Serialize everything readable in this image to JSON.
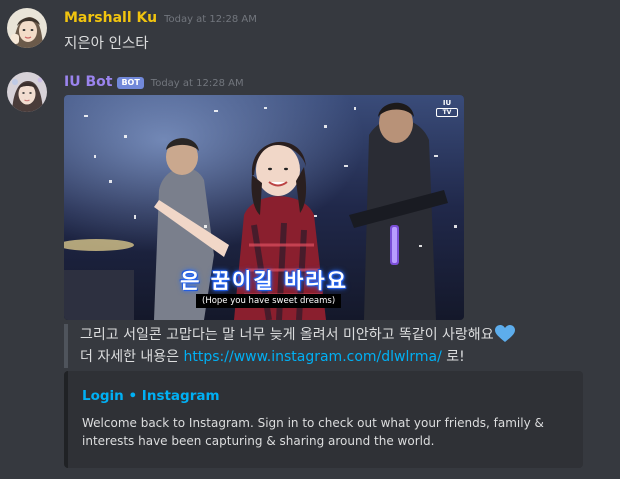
{
  "messages": [
    {
      "username": "Marshall Ku",
      "username_color": "#f1c40f",
      "timestamp": "Today at 12:28 AM",
      "text": "지은아 인스타"
    },
    {
      "username": "IU Bot",
      "username_color": "#9b84ee",
      "bot_tag": "BOT",
      "timestamp": "Today at 12:28 AM",
      "video": {
        "corner_logo_top": "IU",
        "corner_logo_bottom": "TV",
        "overlay_caption": "은 꿈이길 바라요",
        "subtitle": "(Hope you have sweet dreams)"
      },
      "quote": {
        "line1": "그리고 서일콘 고맙다는 말 너무 늦게 올려서 미안하고 똑같이 사랑해요",
        "line1_emoji": "blue-heart-icon",
        "line2_prefix": "더 자세한 내용은 ",
        "line2_link": "https://www.instagram.com/dlwlrma/",
        "line2_suffix": " 로!"
      },
      "embed": {
        "title": "Login • Instagram",
        "description": "Welcome back to Instagram. Sign in to check out what your friends, family & interests have been capturing & sharing around the world."
      }
    }
  ],
  "colors": {
    "background": "#36393f",
    "link": "#00b0f4",
    "bot_tag": "#7289da",
    "embed_background": "#2f3136"
  }
}
